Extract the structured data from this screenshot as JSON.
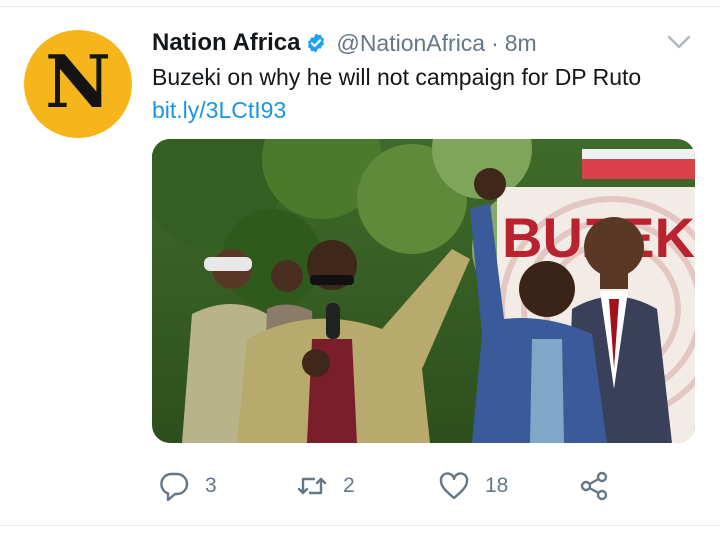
{
  "tweet": {
    "author_initial": "N",
    "display_name": "Nation Africa",
    "handle": "@NationAfrica",
    "separator": "·",
    "timestamp": "8m",
    "text": "Buzeki on why he will not campaign for DP Ruto",
    "link": "bit.ly/3LCtI93"
  },
  "media": {
    "banner_text": "BUZEKI"
  },
  "actions": {
    "reply_count": "3",
    "retweet_count": "2",
    "like_count": "18"
  },
  "icons": {
    "verified": "verified-badge-icon",
    "caret": "chevron-down-icon",
    "reply": "reply-icon",
    "retweet": "retweet-icon",
    "like": "heart-icon",
    "share": "share-icon"
  },
  "colors": {
    "avatar_bg": "#f7b51c",
    "link": "#1b95e0",
    "verified": "#1da1f2",
    "muted": "#657786",
    "text": "#14171a"
  }
}
